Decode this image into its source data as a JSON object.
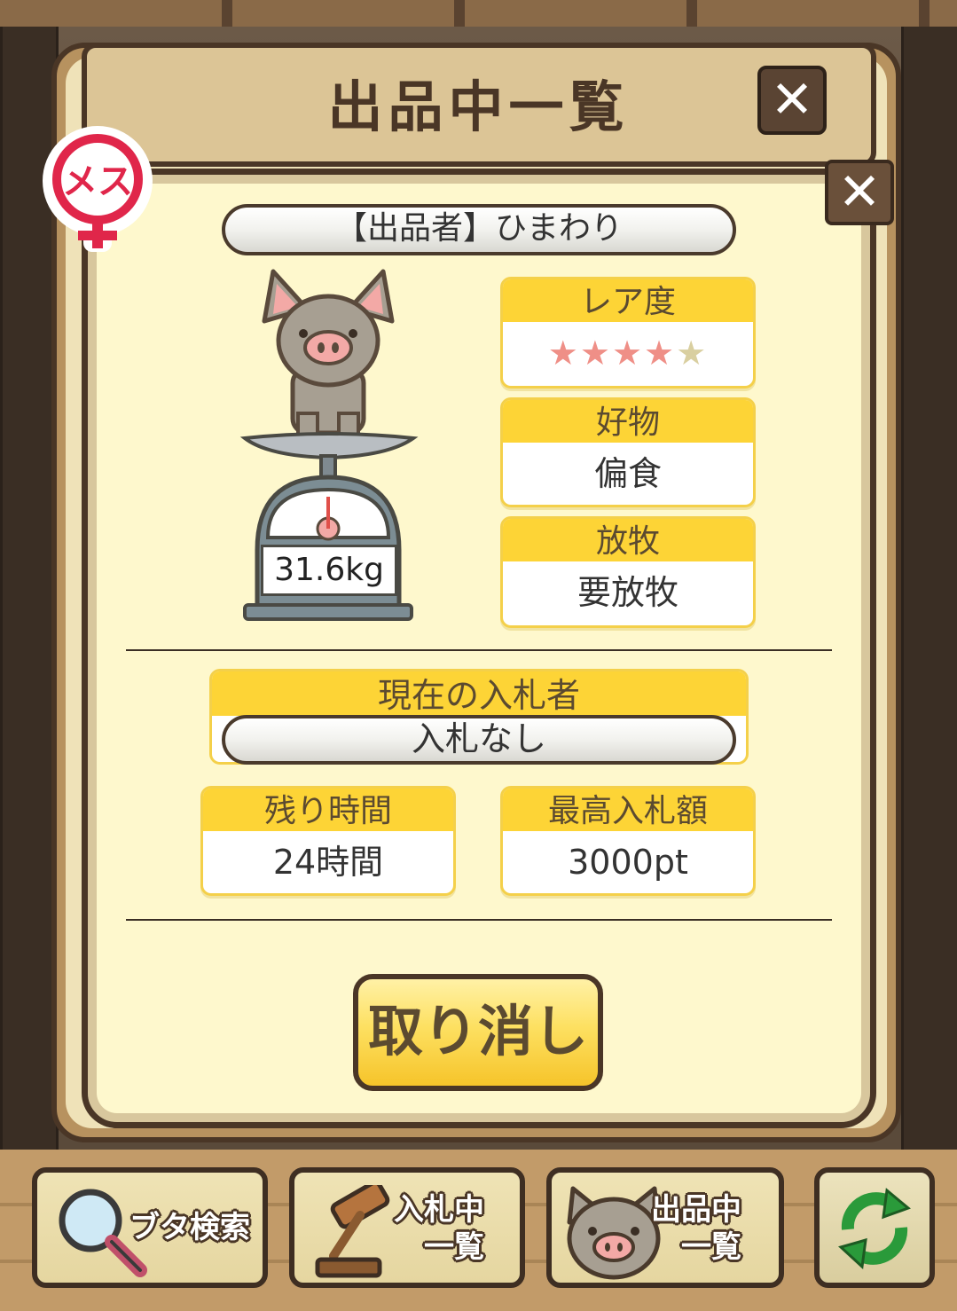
{
  "window": {
    "title": "出品中一覧",
    "close_icon": "close-icon"
  },
  "listing": {
    "gender_badge": "メス",
    "seller_label": "【出品者】ひまわり",
    "weight": "31.6kg",
    "rarity": {
      "label": "レア度",
      "stars_filled": 4,
      "stars_total": 5,
      "star_glyph": "★"
    },
    "favorite": {
      "label": "好物",
      "value": "偏食"
    },
    "grazing": {
      "label": "放牧",
      "value": "要放牧"
    },
    "current_bidder": {
      "label": "現在の入札者",
      "value": "入札なし"
    },
    "remaining_time": {
      "label": "残り時間",
      "value": "24時間"
    },
    "max_bid": {
      "label": "最高入札額",
      "value": "3000pt"
    },
    "cancel_label": "取り消し"
  },
  "nav": {
    "search_label": "ブタ検索",
    "bidding_label_1": "入札中",
    "bidding_label_2": "一覧",
    "listing_label_1": "出品中",
    "listing_label_2": "一覧"
  },
  "colors": {
    "accent_yellow": "#fdd436",
    "panel_bg": "#fef8cd",
    "frame_brown": "#4a3626",
    "star_on": "#ef8f87",
    "star_off": "#d9cfa0",
    "badge_red": "#e0264a"
  }
}
